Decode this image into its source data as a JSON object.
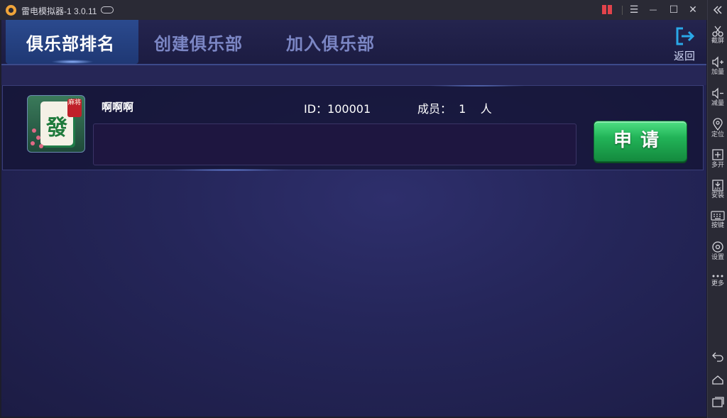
{
  "window": {
    "title": "雷电模拟器-1 3.0.11",
    "controls": {
      "menu": "☰",
      "minimize": "—",
      "maximize": "☐",
      "close": "✕"
    }
  },
  "sidebar": {
    "collapse_icon": "double-chevron-left-icon",
    "items": [
      {
        "icon": "scissors-icon",
        "label": "截屏"
      },
      {
        "icon": "volume-up-icon",
        "label": "加量"
      },
      {
        "icon": "volume-down-icon",
        "label": "减量"
      },
      {
        "icon": "location-pin-icon",
        "label": "定位"
      },
      {
        "icon": "multi-window-icon",
        "label": "多开"
      },
      {
        "icon": "apk-install-icon",
        "label": "安装"
      },
      {
        "icon": "keyboard-icon",
        "label": "按键"
      },
      {
        "icon": "gear-icon",
        "label": "设置"
      },
      {
        "icon": "more-dots-icon",
        "label": "更多"
      }
    ],
    "nav": [
      {
        "icon": "back-arrow-icon"
      },
      {
        "icon": "home-icon"
      },
      {
        "icon": "recent-apps-icon"
      }
    ]
  },
  "game": {
    "tabs": [
      {
        "label": "俱乐部排名",
        "active": true
      },
      {
        "label": "创建俱乐部",
        "active": false
      },
      {
        "label": "加入俱乐部",
        "active": false
      }
    ],
    "back_label": "返回",
    "clubs": [
      {
        "name": "啊啊啊",
        "id_text": "ID：100001",
        "members_text": "成员：  1    人",
        "avatar_glyph": "發",
        "avatar_seal": "麻将",
        "apply_label": "申请"
      }
    ]
  },
  "colors": {
    "accent_green": "#22b458",
    "tab_active": "#ffffff",
    "tab_inactive": "#7b86c4",
    "background": "#25265a"
  }
}
